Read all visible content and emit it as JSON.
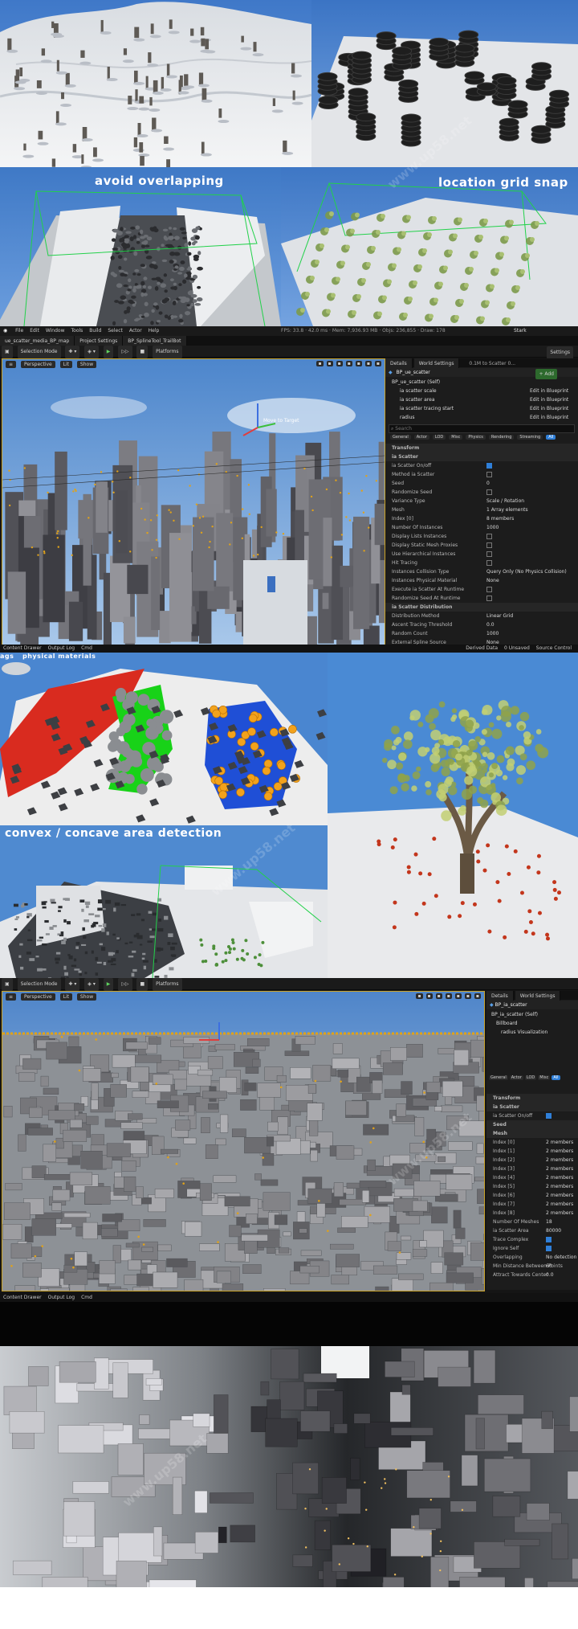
{
  "collage": {
    "p3_title": "avoid overlapping",
    "p4_title": "location grid snap",
    "p5_title": "physical materials",
    "p5_prefix": "ags",
    "p6_title": "convex / concave area detection"
  },
  "editor1": {
    "menu": [
      "File",
      "Edit",
      "Window",
      "Tools",
      "Build",
      "Select",
      "Actor",
      "Help"
    ],
    "stats": "FPS: 33.8 · 42.0 ms · Mem: 7,936.93 MB · Objs: 236,855 · Draw: 178",
    "project_name": "Stark",
    "tabs": [
      "ue_scatter_media_BP_map",
      "Project Settings",
      "BP_SplineTool_TrailBot"
    ],
    "toolbar": {
      "mode": "Selection Mode",
      "platforms": "Platforms",
      "settings": "Settings"
    },
    "viewport": {
      "perspective": "Perspective",
      "lit": "Lit",
      "show": "Show",
      "gizmo_label": "Move to Target"
    },
    "details": {
      "tab_details": "Details",
      "tab_world": "World Settings",
      "scatter_badge": "0.1M to Scatter 0...",
      "actor_name": "BP_ue_scatter",
      "add_label": "+ Add",
      "components": [
        {
          "name": "BP_ue_scatter (Self)",
          "link": ""
        },
        {
          "name": "ia scatter scale",
          "link": "Edit in Blueprint"
        },
        {
          "name": "ia scatter area",
          "link": "Edit in Blueprint"
        },
        {
          "name": "ia scatter tracing start",
          "link": "Edit in Blueprint"
        },
        {
          "name": "radius",
          "link": "Edit in Blueprint"
        }
      ],
      "search_placeholder": "Search",
      "filters": [
        "General",
        "Actor",
        "LOD",
        "Misc",
        "Physics",
        "Rendering",
        "Streaming",
        "All"
      ],
      "rows": [
        {
          "k": "Transform",
          "v": "",
          "sec": true
        },
        {
          "k": "ia Scatter",
          "v": "",
          "sec": true
        },
        {
          "k": "ia Scatter On/off",
          "v": "",
          "chk": true,
          "on": true
        },
        {
          "k": "Method ia Scatter",
          "v": "",
          "chk": true,
          "on": false
        },
        {
          "k": "Seed",
          "v": "0"
        },
        {
          "k": "Randomize Seed",
          "v": "",
          "chk": true,
          "on": false
        },
        {
          "k": "Variance Type",
          "v": "Scale / Rotation"
        },
        {
          "k": "Mesh",
          "v": "1 Array elements"
        },
        {
          "k": "Index [0]",
          "v": "8 members"
        },
        {
          "k": "Number Of Instances",
          "v": "1000"
        },
        {
          "k": "Display Lists Instances",
          "v": "",
          "chk": true,
          "on": false
        },
        {
          "k": "Display Static Mesh Proxies",
          "v": "",
          "chk": true,
          "on": false
        },
        {
          "k": "Use Hierarchical Instances",
          "v": "",
          "chk": true,
          "on": false
        },
        {
          "k": "Hit Tracing",
          "v": "",
          "chk": true,
          "on": false
        },
        {
          "k": "Instances Collision Type",
          "v": "Query Only (No Physics Collision)"
        },
        {
          "k": "Instances Physical Material",
          "v": "None"
        },
        {
          "k": "Execute ia Scatter At Runtime",
          "v": "",
          "chk": true,
          "on": false
        },
        {
          "k": "Randomize Seed At Runtime",
          "v": "",
          "chk": true,
          "on": false
        },
        {
          "k": "ia Scatter Distribution",
          "v": "",
          "sec": true
        },
        {
          "k": "Distribution Method",
          "v": "Linear Grid"
        },
        {
          "k": "Ascent Tracing Threshold",
          "v": "0.0"
        },
        {
          "k": "Random Count",
          "v": "1000"
        },
        {
          "k": "External Spline Source",
          "v": "None"
        }
      ]
    },
    "bottom": [
      "Content Drawer",
      "Output Log",
      "Cmd"
    ],
    "bottom_right": [
      "Derived Data",
      "0 Unsaved",
      "Source Control"
    ]
  },
  "editor2": {
    "toolbar": {
      "mode": "Selection Mode",
      "platforms": "Platforms"
    },
    "viewport": {
      "perspective": "Perspective",
      "lit": "Lit",
      "show": "Show"
    },
    "details": {
      "tab_details": "Details",
      "tab_world": "World Settings",
      "actor_name": "BP_ia_scatter",
      "components": [
        "BP_ia_scatter (Self)",
        "Billboard",
        "radius Visualization"
      ],
      "filters": [
        "General",
        "Actor",
        "LOD",
        "Misc",
        "All"
      ],
      "rows": [
        {
          "k": "Transform",
          "v": "",
          "sec": true
        },
        {
          "k": "ia Scatter",
          "v": "",
          "sec": true
        },
        {
          "k": "ia Scatter On/off",
          "v": "",
          "chk": true,
          "on": true
        },
        {
          "k": "Seed",
          "v": "",
          "sec": true
        },
        {
          "k": "Mesh",
          "v": "",
          "sec": true
        },
        {
          "k": "Index [0]",
          "v": "2 members"
        },
        {
          "k": "Index [1]",
          "v": "2 members"
        },
        {
          "k": "Index [2]",
          "v": "2 members"
        },
        {
          "k": "Index [3]",
          "v": "2 members"
        },
        {
          "k": "Index [4]",
          "v": "2 members"
        },
        {
          "k": "Index [5]",
          "v": "2 members"
        },
        {
          "k": "Index [6]",
          "v": "2 members"
        },
        {
          "k": "Index [7]",
          "v": "2 members"
        },
        {
          "k": "Index [8]",
          "v": "2 members"
        },
        {
          "k": "Number Of Meshes",
          "v": "18"
        },
        {
          "k": "ia Scatter Area",
          "v": "80000"
        },
        {
          "k": "Trace Complex",
          "v": "",
          "chk": true,
          "on": true
        },
        {
          "k": "Ignore Self",
          "v": "",
          "chk": true,
          "on": true
        },
        {
          "k": "Overlapping",
          "v": "No detection"
        },
        {
          "k": "Min Distance Between Points",
          "v": "60"
        },
        {
          "k": "Attract Towards Center",
          "v": "0.0"
        }
      ]
    },
    "bottom": [
      "Content Drawer",
      "Output Log",
      "Cmd"
    ]
  },
  "watermark": "www.up58.net",
  "colors": {
    "ue_bg": "#151515",
    "accent": "#2f7fd8",
    "selection": "#c9a227"
  }
}
